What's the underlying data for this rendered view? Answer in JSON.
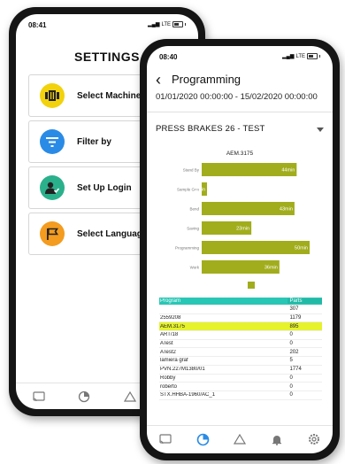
{
  "settings_screen": {
    "status": {
      "time": "08:41",
      "signal": "LTE"
    },
    "title": "SETTINGS",
    "items": [
      {
        "label": "Select Machine",
        "icon": "machine-icon",
        "color": "#f2d20c"
      },
      {
        "label": "Filter by",
        "icon": "filter-icon",
        "color": "#2a8be6"
      },
      {
        "label": "Set Up Login",
        "icon": "user-login-icon",
        "color": "#2bb08c"
      },
      {
        "label": "Select Language",
        "icon": "flag-icon",
        "color": "#f39c1f"
      }
    ]
  },
  "programming_screen": {
    "status": {
      "time": "08:40",
      "signal": "LTE"
    },
    "title": "Programming",
    "date_range": "01/01/2020 00:00:00  -  15/02/2020 00:00:00",
    "machine": "PRESS BRAKES 26 - TEST",
    "chart_data": {
      "type": "bar",
      "orientation": "horizontal",
      "title": "AEM.3175",
      "categories": [
        "Stand By",
        "Sample Gen",
        "Bend",
        "Saving",
        "Programming",
        "Work"
      ],
      "values": [
        44,
        2,
        43,
        23,
        50,
        36
      ],
      "value_labels": [
        "44min",
        "2min",
        "43min",
        "23min",
        "50min",
        "36min"
      ],
      "unit": "min",
      "color": "#a1ad1c"
    },
    "table": {
      "columns": [
        "Program",
        "Parts"
      ],
      "rows": [
        {
          "name": "",
          "value": "307"
        },
        {
          "name": "2559208",
          "value": "1179"
        },
        {
          "name": "AEM.3175",
          "value": "895",
          "highlight": true
        },
        {
          "name": "ART/18",
          "value": "0"
        },
        {
          "name": "ATest",
          "value": "0"
        },
        {
          "name": "ATest2",
          "value": "202"
        },
        {
          "name": "lamiera graf",
          "value": "5"
        },
        {
          "name": "PVN.227M1380/01",
          "value": "1774"
        },
        {
          "name": "Robby",
          "value": "0"
        },
        {
          "name": "roberto",
          "value": "0"
        },
        {
          "name": "STX.HHBA-1960/AC_1",
          "value": "0"
        }
      ]
    }
  },
  "colors": {
    "accent": "#2a8be6",
    "teal": "#28c7b5",
    "highlight": "#e5f22c",
    "bar": "#a1ad1c"
  }
}
